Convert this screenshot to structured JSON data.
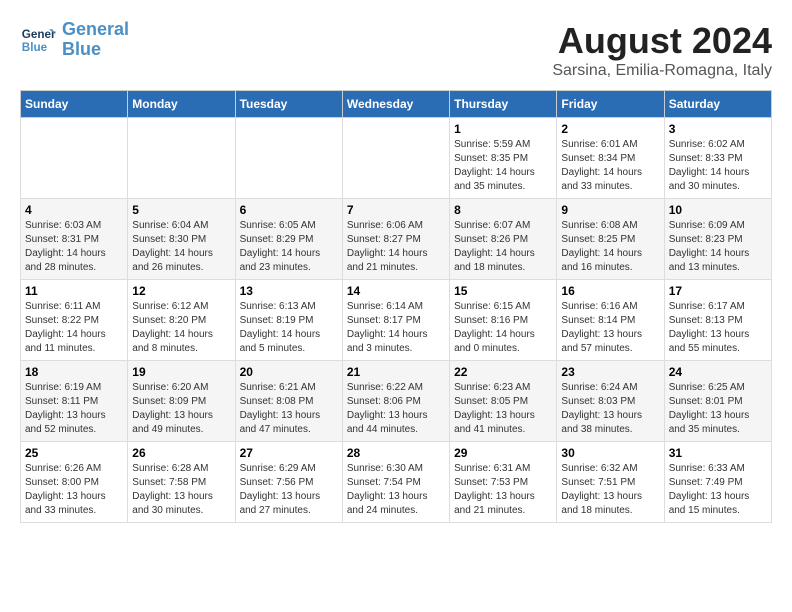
{
  "logo": {
    "line1": "General",
    "line2": "Blue"
  },
  "title": "August 2024",
  "subtitle": "Sarsina, Emilia-Romagna, Italy",
  "headers": [
    "Sunday",
    "Monday",
    "Tuesday",
    "Wednesday",
    "Thursday",
    "Friday",
    "Saturday"
  ],
  "weeks": [
    [
      {
        "num": "",
        "info": ""
      },
      {
        "num": "",
        "info": ""
      },
      {
        "num": "",
        "info": ""
      },
      {
        "num": "",
        "info": ""
      },
      {
        "num": "1",
        "info": "Sunrise: 5:59 AM\nSunset: 8:35 PM\nDaylight: 14 hours\nand 35 minutes."
      },
      {
        "num": "2",
        "info": "Sunrise: 6:01 AM\nSunset: 8:34 PM\nDaylight: 14 hours\nand 33 minutes."
      },
      {
        "num": "3",
        "info": "Sunrise: 6:02 AM\nSunset: 8:33 PM\nDaylight: 14 hours\nand 30 minutes."
      }
    ],
    [
      {
        "num": "4",
        "info": "Sunrise: 6:03 AM\nSunset: 8:31 PM\nDaylight: 14 hours\nand 28 minutes."
      },
      {
        "num": "5",
        "info": "Sunrise: 6:04 AM\nSunset: 8:30 PM\nDaylight: 14 hours\nand 26 minutes."
      },
      {
        "num": "6",
        "info": "Sunrise: 6:05 AM\nSunset: 8:29 PM\nDaylight: 14 hours\nand 23 minutes."
      },
      {
        "num": "7",
        "info": "Sunrise: 6:06 AM\nSunset: 8:27 PM\nDaylight: 14 hours\nand 21 minutes."
      },
      {
        "num": "8",
        "info": "Sunrise: 6:07 AM\nSunset: 8:26 PM\nDaylight: 14 hours\nand 18 minutes."
      },
      {
        "num": "9",
        "info": "Sunrise: 6:08 AM\nSunset: 8:25 PM\nDaylight: 14 hours\nand 16 minutes."
      },
      {
        "num": "10",
        "info": "Sunrise: 6:09 AM\nSunset: 8:23 PM\nDaylight: 14 hours\nand 13 minutes."
      }
    ],
    [
      {
        "num": "11",
        "info": "Sunrise: 6:11 AM\nSunset: 8:22 PM\nDaylight: 14 hours\nand 11 minutes."
      },
      {
        "num": "12",
        "info": "Sunrise: 6:12 AM\nSunset: 8:20 PM\nDaylight: 14 hours\nand 8 minutes."
      },
      {
        "num": "13",
        "info": "Sunrise: 6:13 AM\nSunset: 8:19 PM\nDaylight: 14 hours\nand 5 minutes."
      },
      {
        "num": "14",
        "info": "Sunrise: 6:14 AM\nSunset: 8:17 PM\nDaylight: 14 hours\nand 3 minutes."
      },
      {
        "num": "15",
        "info": "Sunrise: 6:15 AM\nSunset: 8:16 PM\nDaylight: 14 hours\nand 0 minutes."
      },
      {
        "num": "16",
        "info": "Sunrise: 6:16 AM\nSunset: 8:14 PM\nDaylight: 13 hours\nand 57 minutes."
      },
      {
        "num": "17",
        "info": "Sunrise: 6:17 AM\nSunset: 8:13 PM\nDaylight: 13 hours\nand 55 minutes."
      }
    ],
    [
      {
        "num": "18",
        "info": "Sunrise: 6:19 AM\nSunset: 8:11 PM\nDaylight: 13 hours\nand 52 minutes."
      },
      {
        "num": "19",
        "info": "Sunrise: 6:20 AM\nSunset: 8:09 PM\nDaylight: 13 hours\nand 49 minutes."
      },
      {
        "num": "20",
        "info": "Sunrise: 6:21 AM\nSunset: 8:08 PM\nDaylight: 13 hours\nand 47 minutes."
      },
      {
        "num": "21",
        "info": "Sunrise: 6:22 AM\nSunset: 8:06 PM\nDaylight: 13 hours\nand 44 minutes."
      },
      {
        "num": "22",
        "info": "Sunrise: 6:23 AM\nSunset: 8:05 PM\nDaylight: 13 hours\nand 41 minutes."
      },
      {
        "num": "23",
        "info": "Sunrise: 6:24 AM\nSunset: 8:03 PM\nDaylight: 13 hours\nand 38 minutes."
      },
      {
        "num": "24",
        "info": "Sunrise: 6:25 AM\nSunset: 8:01 PM\nDaylight: 13 hours\nand 35 minutes."
      }
    ],
    [
      {
        "num": "25",
        "info": "Sunrise: 6:26 AM\nSunset: 8:00 PM\nDaylight: 13 hours\nand 33 minutes."
      },
      {
        "num": "26",
        "info": "Sunrise: 6:28 AM\nSunset: 7:58 PM\nDaylight: 13 hours\nand 30 minutes."
      },
      {
        "num": "27",
        "info": "Sunrise: 6:29 AM\nSunset: 7:56 PM\nDaylight: 13 hours\nand 27 minutes."
      },
      {
        "num": "28",
        "info": "Sunrise: 6:30 AM\nSunset: 7:54 PM\nDaylight: 13 hours\nand 24 minutes."
      },
      {
        "num": "29",
        "info": "Sunrise: 6:31 AM\nSunset: 7:53 PM\nDaylight: 13 hours\nand 21 minutes."
      },
      {
        "num": "30",
        "info": "Sunrise: 6:32 AM\nSunset: 7:51 PM\nDaylight: 13 hours\nand 18 minutes."
      },
      {
        "num": "31",
        "info": "Sunrise: 6:33 AM\nSunset: 7:49 PM\nDaylight: 13 hours\nand 15 minutes."
      }
    ]
  ]
}
